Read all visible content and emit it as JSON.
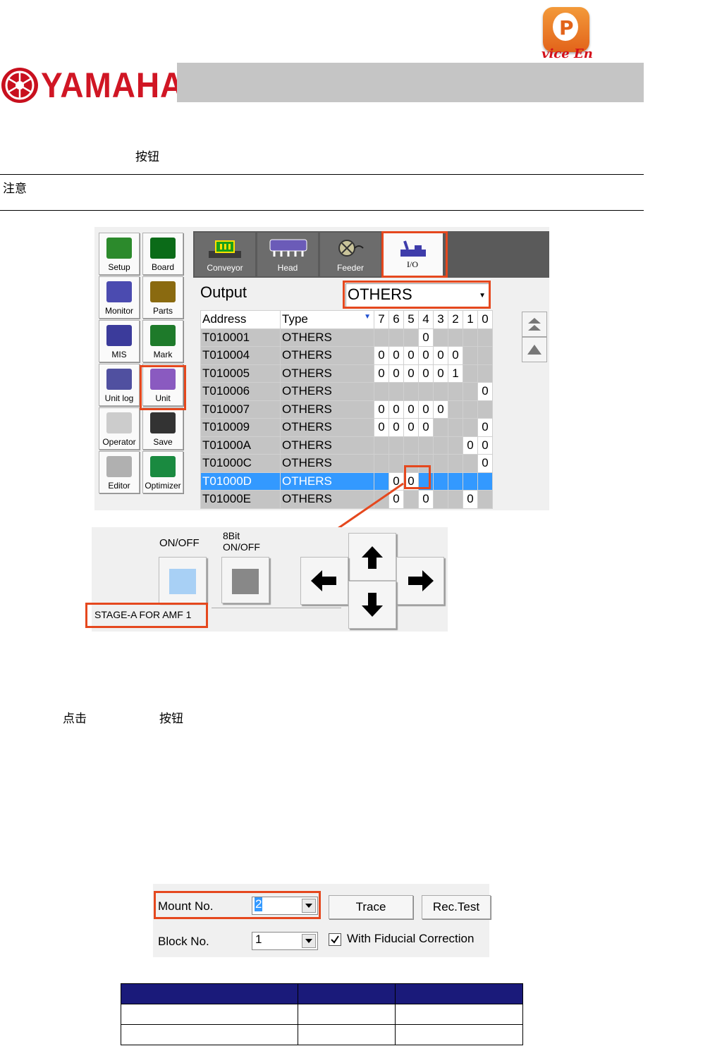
{
  "header": {
    "logo_badge_letter": "P",
    "logo_subtitle": "vice  En",
    "brand": "YAMAHA"
  },
  "text": {
    "line1": "按钮",
    "note": "注意",
    "click_a": "点击",
    "click_b": "按钮"
  },
  "nav_buttons": [
    {
      "label": "Setup",
      "icon": "setup-icon"
    },
    {
      "label": "Board",
      "icon": "board-icon"
    },
    {
      "label": "Monitor",
      "icon": "monitor-icon"
    },
    {
      "label": "Parts",
      "icon": "parts-icon"
    },
    {
      "label": "MIS",
      "icon": "mis-icon"
    },
    {
      "label": "Mark",
      "icon": "mark-icon"
    },
    {
      "label": "Unit log",
      "icon": "unit-log-icon"
    },
    {
      "label": "Unit",
      "icon": "unit-icon"
    },
    {
      "label": "Operator",
      "icon": "operator-icon"
    },
    {
      "label": "Save",
      "icon": "save-icon"
    },
    {
      "label": "Editor",
      "icon": "editor-icon"
    },
    {
      "label": "Optimizer",
      "icon": "optimizer-icon"
    }
  ],
  "tabs": [
    {
      "label": "Conveyor",
      "icon": "conveyor-icon"
    },
    {
      "label": "Head",
      "icon": "head-icon"
    },
    {
      "label": "Feeder",
      "icon": "feeder-icon"
    },
    {
      "label": "I/O",
      "icon": "io-icon"
    }
  ],
  "output": {
    "label": "Output",
    "select_value": "OTHERS"
  },
  "io_table": {
    "headers": [
      "Address",
      "Type",
      "7",
      "6",
      "5",
      "4",
      "3",
      "2",
      "1",
      "0"
    ],
    "rows": [
      {
        "address": "T010001",
        "type": "OTHERS",
        "bits": [
          "",
          "",
          "",
          "0",
          "",
          "",
          "",
          ""
        ]
      },
      {
        "address": "T010004",
        "type": "OTHERS",
        "bits": [
          "0",
          "0",
          "0",
          "0",
          "0",
          "0",
          "",
          ""
        ]
      },
      {
        "address": "T010005",
        "type": "OTHERS",
        "bits": [
          "0",
          "0",
          "0",
          "0",
          "0",
          "1",
          "",
          ""
        ]
      },
      {
        "address": "T010006",
        "type": "OTHERS",
        "bits": [
          "",
          "",
          "",
          "",
          "",
          "",
          "",
          "0"
        ]
      },
      {
        "address": "T010007",
        "type": "OTHERS",
        "bits": [
          "0",
          "0",
          "0",
          "0",
          "0",
          "",
          "",
          ""
        ]
      },
      {
        "address": "T010009",
        "type": "OTHERS",
        "bits": [
          "0",
          "0",
          "0",
          "0",
          "",
          "",
          "",
          "0"
        ]
      },
      {
        "address": "T01000A",
        "type": "OTHERS",
        "bits": [
          "",
          "",
          "",
          "",
          "",
          "",
          "0",
          "0"
        ]
      },
      {
        "address": "T01000C",
        "type": "OTHERS",
        "bits": [
          "",
          "",
          "",
          "",
          "",
          "",
          "",
          "0"
        ]
      },
      {
        "address": "T01000D",
        "type": "OTHERS",
        "bits": [
          "",
          "0",
          "0",
          "",
          "",
          "",
          "",
          ""
        ]
      },
      {
        "address": "T01000E",
        "type": "OTHERS",
        "bits": [
          "",
          "0",
          "",
          "0",
          "",
          "",
          "0",
          ""
        ]
      }
    ]
  },
  "control_panel": {
    "onoff_label": "ON/OFF",
    "bit8_label_1": "8Bit",
    "bit8_label_2": "ON/OFF",
    "signal_name": "STAGE-A FOR AMF 1",
    "onoff_color": "#a8d0f5",
    "bit8_color": "#888888"
  },
  "mount": {
    "mount_label": "Mount No.",
    "mount_value": "2",
    "trace_label": "Trace",
    "rectest_label": "Rec.Test",
    "block_label": "Block No.",
    "block_value": "1",
    "fiducial_label": "With Fiducial Correction",
    "fiducial_checked": true
  },
  "colors": {
    "highlight": "#e5481e",
    "selected_row": "#3399ff",
    "table_header": "#1a1a7a"
  }
}
